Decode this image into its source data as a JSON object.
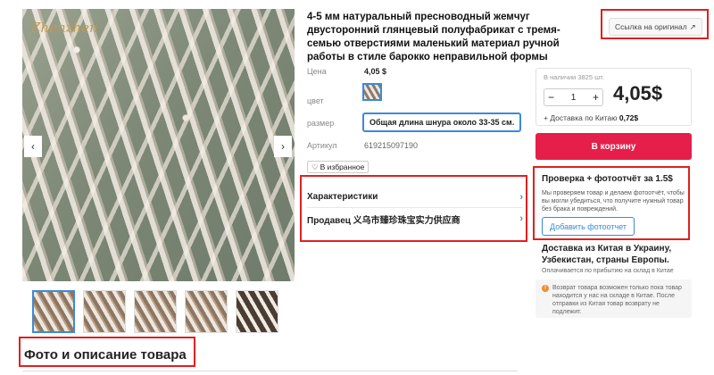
{
  "product": {
    "title": "4-5 мм натуральный пресноводный жемчуг двусторонний глянцевый полуфабрикат с тремя-семью отверстиями маленький материал ручной работы в стиле барокко неправильной формы",
    "brand_watermark": "Zhenzhen",
    "original_link": "Ссылка на оригинал",
    "original_link_icon": "arrow-up-right-icon"
  },
  "gallery": {
    "prev_icon": "‹",
    "next_icon": "›",
    "thumbnail_count": 5
  },
  "props": {
    "price_label": "Цена",
    "price_value": "4,05 $",
    "color_label": "цвет",
    "size_label": "размер",
    "size_value": "Общая длина шнура около 33-35 см.",
    "article_label": "Артикул",
    "article_value": "619215097190",
    "favorite_label": "В избранное",
    "favorite_icon": "♡"
  },
  "links": {
    "characteristics": "Характеристики",
    "seller": "Продавец 义乌市臻珍珠宝实力供应商",
    "chevron": "›"
  },
  "buy": {
    "stock": "В наличии 3825 шт.",
    "qty_minus": "−",
    "qty_value": "1",
    "qty_plus": "+",
    "price": "4,05$",
    "delivery_label": "+ Доставка по Китаю",
    "delivery_value": "0,72$",
    "cart_button": "В корзину",
    "accent_color": "#e51f4a"
  },
  "photo_report": {
    "title": "Проверка + фотоотчёт за 1.5$",
    "description": "Мы проверяем товар и делаем фотоотчёт, чтобы вы могли убедиться, что получите нужный товар без брака и повреждений.",
    "button": "Добавить фотоотчет"
  },
  "shipping": {
    "title": "Доставка из Китая в Украину, Узбекистан, страны Европы.",
    "note": "Оплачивается по прибытию на склад в Китае",
    "return_icon": "!",
    "return_text": "Возврат товара возможен только пока товар находится у нас на складе в Китае. После отправки из Китая товар возврату не подлежит."
  },
  "section": {
    "title": "Фото и описание товара"
  }
}
